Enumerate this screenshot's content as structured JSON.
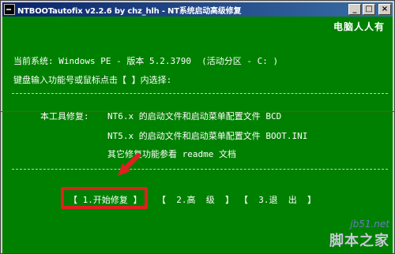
{
  "window": {
    "title": "NTBOOTautofix v2.2.6 by chz_hlh - NT系统启动高级修复",
    "min_icon": "minimize-icon",
    "max_icon": "maximize-icon",
    "close_icon": "close-icon",
    "min_label": "_",
    "max_label": "□",
    "close_label": "×"
  },
  "console": {
    "brand": "电脑人人有",
    "system_line": "当前系统: Windows PE - 版本 5.2.3790  (活动分区 - C: )",
    "prompt_line": "键盘输入功能号或鼠标点击【 】内选择:",
    "divider": "------------------------------------------------------------",
    "repair_label": "本工具修复:",
    "repair_nt6": "NT6.x 的启动文件和启动菜单配置文件 BCD",
    "repair_nt5": "NT5.x 的启动文件和启动菜单配置文件 BOOT.INI",
    "repair_other": "其它修复功能参看 readme 文档"
  },
  "menu": {
    "items": [
      {
        "label": "【 1.开始修复 】"
      },
      {
        "label": "【  2.高  级  】"
      },
      {
        "label": "【  3.退  出  】"
      }
    ]
  },
  "watermark": {
    "url": "jb51.net",
    "name": "脚本之家"
  },
  "colors": {
    "console_bg": "#008000",
    "highlight": "#e02020",
    "title_bar": "#0a246a"
  }
}
